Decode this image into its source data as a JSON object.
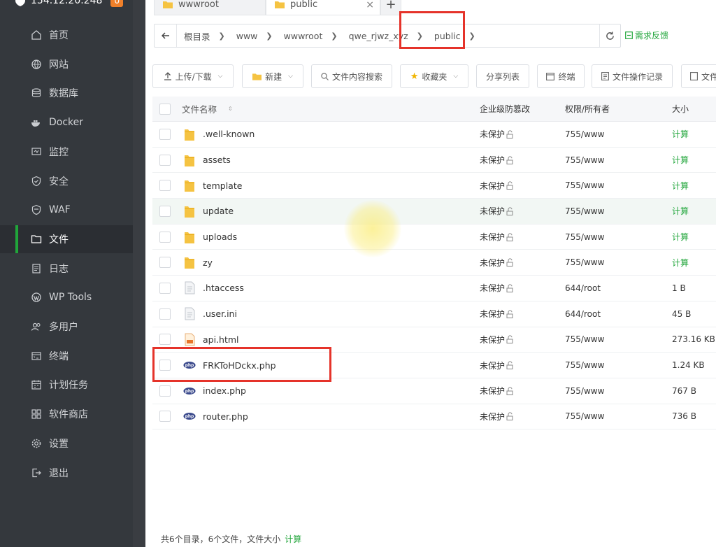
{
  "server": {
    "ip": "154.12.20.248",
    "badge": "0"
  },
  "sidebar": {
    "items": [
      {
        "label": "首页",
        "icon": "home-icon"
      },
      {
        "label": "网站",
        "icon": "globe-icon"
      },
      {
        "label": "数据库",
        "icon": "database-icon"
      },
      {
        "label": "Docker",
        "icon": "docker-icon"
      },
      {
        "label": "监控",
        "icon": "monitor-icon"
      },
      {
        "label": "安全",
        "icon": "shield-check-icon"
      },
      {
        "label": "WAF",
        "icon": "shield-icon"
      },
      {
        "label": "文件",
        "icon": "folder-icon",
        "active": true
      },
      {
        "label": "日志",
        "icon": "log-icon"
      },
      {
        "label": "WP Tools",
        "icon": "wordpress-icon"
      },
      {
        "label": "多用户",
        "icon": "users-icon"
      },
      {
        "label": "终端",
        "icon": "terminal-icon"
      },
      {
        "label": "计划任务",
        "icon": "calendar-icon"
      },
      {
        "label": "软件商店",
        "icon": "apps-icon"
      },
      {
        "label": "设置",
        "icon": "gear-icon"
      },
      {
        "label": "退出",
        "icon": "logout-icon"
      }
    ]
  },
  "tabs": [
    {
      "label": "wwwroot",
      "active": false
    },
    {
      "label": "public",
      "active": true,
      "close": "×"
    }
  ],
  "tab_add": "+",
  "breadcrumb": [
    "根目录",
    "www",
    "wwwroot",
    "qwe_rjwz_xyz",
    "public"
  ],
  "feedback": "需求反馈",
  "toolbar": {
    "upload": "上传/下载",
    "new": "新建",
    "search": "文件内容搜索",
    "favorites": "收藏夹",
    "share": "分享列表",
    "terminal": "终端",
    "oplog": "文件操作记录",
    "more": "文件"
  },
  "columns": {
    "name": "文件名称",
    "protect": "企业级防篡改",
    "perm": "权限/所有者",
    "size": "大小"
  },
  "files": [
    {
      "name": ".well-known",
      "type": "folder",
      "protect": "未保护",
      "perm": "755/www",
      "size": "计算"
    },
    {
      "name": "assets",
      "type": "folder",
      "protect": "未保护",
      "perm": "755/www",
      "size": "计算"
    },
    {
      "name": "template",
      "type": "folder",
      "protect": "未保护",
      "perm": "755/www",
      "size": "计算"
    },
    {
      "name": "update",
      "type": "folder",
      "protect": "未保护",
      "perm": "755/www",
      "size": "计算"
    },
    {
      "name": "uploads",
      "type": "folder",
      "protect": "未保护",
      "perm": "755/www",
      "size": "计算"
    },
    {
      "name": "zy",
      "type": "folder",
      "protect": "未保护",
      "perm": "755/www",
      "size": "计算"
    },
    {
      "name": ".htaccess",
      "type": "file",
      "protect": "未保护",
      "perm": "644/root",
      "size": "1 B"
    },
    {
      "name": ".user.ini",
      "type": "file",
      "protect": "未保护",
      "perm": "644/root",
      "size": "45 B"
    },
    {
      "name": "api.html",
      "type": "html",
      "protect": "未保护",
      "perm": "755/www",
      "size": "273.16 KB"
    },
    {
      "name": "FRKToHDckx.php",
      "type": "php",
      "protect": "未保护",
      "perm": "755/www",
      "size": "1.24 KB"
    },
    {
      "name": "index.php",
      "type": "php",
      "protect": "未保护",
      "perm": "755/www",
      "size": "767 B"
    },
    {
      "name": "router.php",
      "type": "php",
      "protect": "未保护",
      "perm": "755/www",
      "size": "736 B"
    }
  ],
  "footer": {
    "summary": "共6个目录，6个文件，文件大小",
    "calc": "计算"
  },
  "colors": {
    "accent": "#20a53a",
    "sidebar_bg": "#34383d",
    "highlight": "#e5332a",
    "folder": "#f5c342",
    "badge": "#f0802a"
  }
}
